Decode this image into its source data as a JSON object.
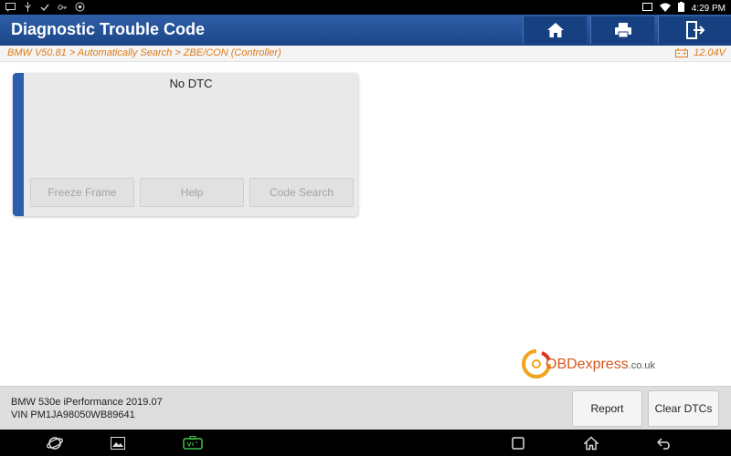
{
  "status_bar": {
    "left_icons": [
      "message-icon",
      "usb-icon",
      "check-icon",
      "vpn-icon",
      "settings-icon"
    ],
    "time": "4:29 PM"
  },
  "header": {
    "title": "Diagnostic Trouble Code",
    "buttons": [
      "home-icon",
      "print-icon",
      "exit-icon"
    ]
  },
  "breadcrumb": "BMW V50.81 > Automatically Search > ZBE/CON (Controller)",
  "battery_voltage": "12.04V",
  "dtc_card": {
    "message": "No DTC",
    "buttons": {
      "freeze_frame": "Freeze Frame",
      "help": "Help",
      "code_search": "Code Search"
    }
  },
  "watermark": {
    "brand": "OBDexpress",
    "suffix": ".co.uk"
  },
  "vehicle": {
    "model": "BMW 530e iPerformance 2019.07",
    "vin": "VIN PM1JA98050WB89641"
  },
  "bottom_buttons": {
    "report": "Report",
    "clear_dtcs": "Clear DTCs"
  },
  "nav_bar": [
    "browser-icon",
    "gallery-icon",
    "vci-icon",
    "recents-icon",
    "home-icon",
    "back-icon"
  ],
  "colors": {
    "header": "#1f4d92",
    "accent": "#2a5fb0",
    "breadcrumb_text": "#e07b16"
  }
}
